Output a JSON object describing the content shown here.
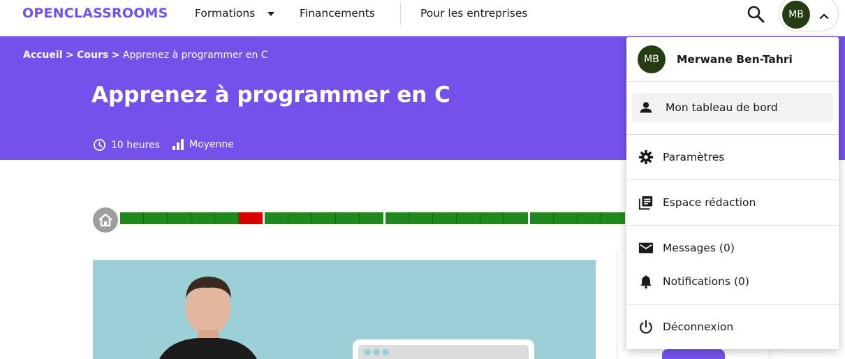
{
  "header": {
    "logo": "OPENCLASSROOMS",
    "nav": [
      {
        "label": "Formations"
      },
      {
        "label": "Financements"
      },
      {
        "label": "Pour les entreprises"
      }
    ],
    "user_initials": "MB"
  },
  "hero": {
    "breadcrumb": [
      {
        "label": "Accueil"
      },
      {
        "label": "Cours"
      },
      {
        "label": "Apprenez à programmer en C"
      }
    ],
    "separator": ">",
    "title": "Apprenez à programmer en C",
    "duration": "10 heures",
    "level": "Moyenne"
  },
  "progress": {
    "parts": [
      {
        "segments": [
          "done",
          "done",
          "done",
          "done",
          "done",
          "current"
        ]
      },
      {
        "segments": [
          "done",
          "done",
          "done",
          "done",
          "done"
        ]
      },
      {
        "segments": [
          "done",
          "done",
          "done",
          "done",
          "done",
          "done"
        ]
      },
      {
        "segments": [
          "done",
          "done",
          "done",
          "done"
        ]
      }
    ],
    "colors": {
      "done": "#1e8a1e",
      "current": "#dd0000"
    }
  },
  "menu": {
    "user_initials": "MB",
    "user_name": "Merwane Ben-Tahri",
    "items": [
      {
        "label": "Mon tableau de bord",
        "icon": "person-icon"
      },
      {
        "label": "Paramètres",
        "icon": "gear-icon"
      },
      {
        "label": "Espace rédaction",
        "icon": "library-icon"
      },
      {
        "label": "Messages (0)",
        "icon": "mail-icon"
      },
      {
        "label": "Notifications (0)",
        "icon": "bell-icon"
      },
      {
        "label": "Déconnexion",
        "icon": "power-icon"
      }
    ]
  },
  "colors": {
    "brand": "#7451eb",
    "avatar": "#263d14"
  }
}
